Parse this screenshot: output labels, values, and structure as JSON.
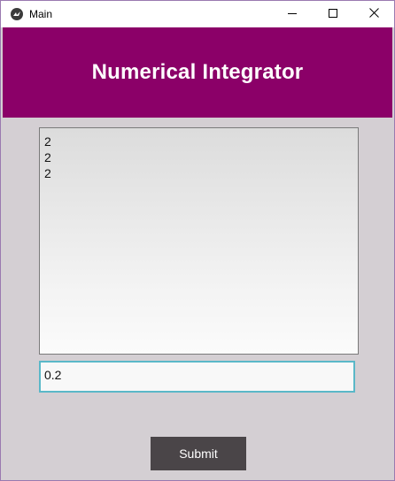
{
  "window": {
    "title": "Main"
  },
  "header": {
    "title": "Numerical Integrator"
  },
  "output": {
    "lines": [
      "2",
      "2",
      "2"
    ]
  },
  "input": {
    "value": "0.2"
  },
  "actions": {
    "submit_label": "Submit"
  },
  "colors": {
    "header_bg": "#8b0068",
    "body_bg": "#d4cfd3",
    "input_border": "#5ab8c8",
    "button_bg": "#4a4548"
  },
  "icons": {
    "app": "kivy-icon",
    "minimize": "minimize-icon",
    "maximize": "maximize-icon",
    "close": "close-icon"
  }
}
